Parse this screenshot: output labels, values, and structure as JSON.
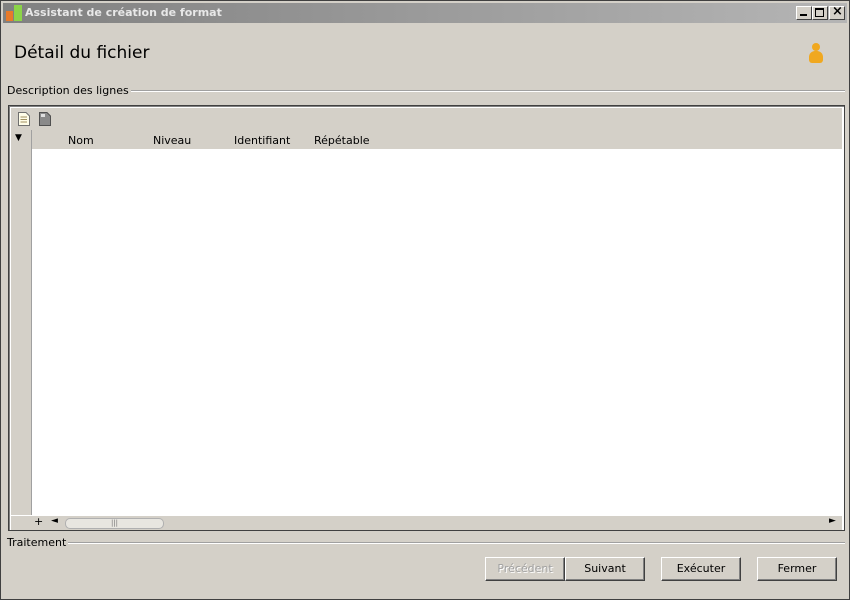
{
  "window": {
    "title": "Assistant de création de format",
    "minimize_glyph": "_",
    "maximize_glyph": "□",
    "close_glyph": "×"
  },
  "header": {
    "title": "Détail du fichier",
    "user_icon": "user-icon"
  },
  "lines_group": {
    "label": "Description des lignes",
    "toolbar": [
      {
        "icon": "new-document-icon"
      },
      {
        "icon": "document-icon"
      }
    ],
    "columns": [
      "Nom",
      "Niveau",
      "Identifiant",
      "Répétable"
    ],
    "rows": [],
    "expand_glyph": "▼",
    "add_row_glyph": "+",
    "scroll_left_glyph": "◄",
    "scroll_right_glyph": "►",
    "scroll_thumb_grip": "|||"
  },
  "treatment_group": {
    "label": "Traitement"
  },
  "buttons": {
    "previous": "Précédent",
    "next": "Suivant",
    "execute": "Exécuter",
    "close": "Fermer"
  }
}
